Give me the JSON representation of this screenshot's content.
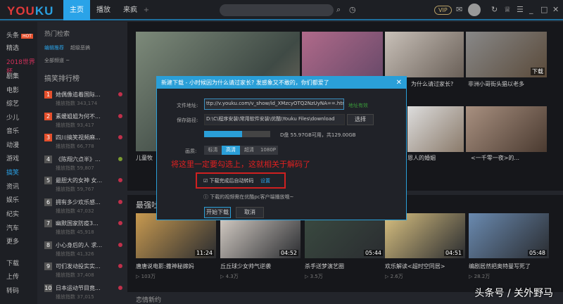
{
  "header": {
    "logo": [
      "YOU",
      "KU"
    ],
    "tabs": [
      "主页",
      "播放",
      "来疯"
    ],
    "add": "+",
    "vip": "VIP"
  },
  "sidebar": {
    "items": [
      "头条",
      "精选",
      "2018世界杯",
      "剧集",
      "电影",
      "综艺",
      "少儿",
      "音乐",
      "动漫",
      "游戏",
      "搞笑",
      "资讯",
      "娱乐",
      "纪实",
      "汽车",
      "更多",
      "下载",
      "上传",
      "转码"
    ],
    "hot_badge": "HOT"
  },
  "panel": {
    "title": "热门检索",
    "subtabs": [
      "编辑推荐",
      "超级恶搞"
    ],
    "filter": "全部频道 ~",
    "rank_title": "搞笑排行榜",
    "ranks": [
      {
        "n": "1",
        "title": "她偶像追着国际...",
        "views": "播放指数 343,174"
      },
      {
        "n": "2",
        "title": "素媛姐姐为何不...",
        "views": "播放指数 93,417"
      },
      {
        "n": "3",
        "title": "四川搞笑视频麻...",
        "views": "播放指数 66,778"
      },
      {
        "n": "4",
        "title": "《陈翔六点半》...",
        "views": "播放指数 59,807"
      },
      {
        "n": "5",
        "title": "最胆大的女神 女...",
        "views": "播放指数 59,767"
      },
      {
        "n": "6",
        "title": "拥有多少欢乐感...",
        "views": "播放指数 47,032"
      },
      {
        "n": "7",
        "title": "幽默国家防疫3...",
        "views": "播放指数 45,918"
      },
      {
        "n": "8",
        "title": "小心身后的人 求...",
        "views": "播放指数 41,326"
      },
      {
        "n": "9",
        "title": "可们发动投实实...",
        "views": "播放指数 37,408"
      },
      {
        "n": "10",
        "title": "日本运动节目竟...",
        "views": "播放指数 37,015"
      }
    ]
  },
  "feed": {
    "top_titles": [
      "为什么请过家长?",
      "非洲小哥街头猖以老多",
      "儿童牧",
      "恩人的婚姻",
      "<一千零一夜>的..."
    ],
    "badge": "下载",
    "section": "最强吐",
    "next_section": "恋情新约",
    "videos": [
      {
        "title": "唐唐说电影:撒神秘嫁妈",
        "views": "103万",
        "dur": "11:24"
      },
      {
        "title": "丘丘球少女帅气逆袭",
        "views": "4.3万",
        "dur": "04:52"
      },
      {
        "title": "杀手送梦演艺圈",
        "views": "3.5万",
        "dur": "05:44"
      },
      {
        "title": "欢乐解读<超时空同居>",
        "views": "2.6万",
        "dur": "04:51"
      },
      {
        "title": "编剧居然把奥特曼写死了",
        "views": "28.2万",
        "dur": "05:48"
      }
    ]
  },
  "dialog": {
    "title": "新建下载 - 小时候因为什么请过家长? 发感象又不敢的，你们都爱了",
    "url_label": "文件地址:",
    "url": "ttp://v.youku.com/v_show/id_XMzcyOTQ2NzUyNA==.html",
    "url_ok": "地址有效",
    "path_label": "保存路径:",
    "path": "D:\\C\\程序安装\\常用软件安装\\优酷\\Youku Files\\download",
    "choose": "选择",
    "disk": "D盘 55.97GB可用，共129.00GB",
    "disk_used": 0.57,
    "quality_label": "画质:",
    "qualities": [
      "标清",
      "高清",
      "超清",
      "1080P"
    ],
    "quality_selected": "高清",
    "annotation": "将这里一定要勾选上，这就相关于解码了",
    "auto_transcode": "下载完成后自动转码",
    "auto_transcode_checked": true,
    "settings": "设置",
    "hint": "下载的视频需在优酷pc客户端播放哦~",
    "start": "开始下载",
    "cancel": "取消"
  },
  "watermark": "头条号 / 关外野马"
}
